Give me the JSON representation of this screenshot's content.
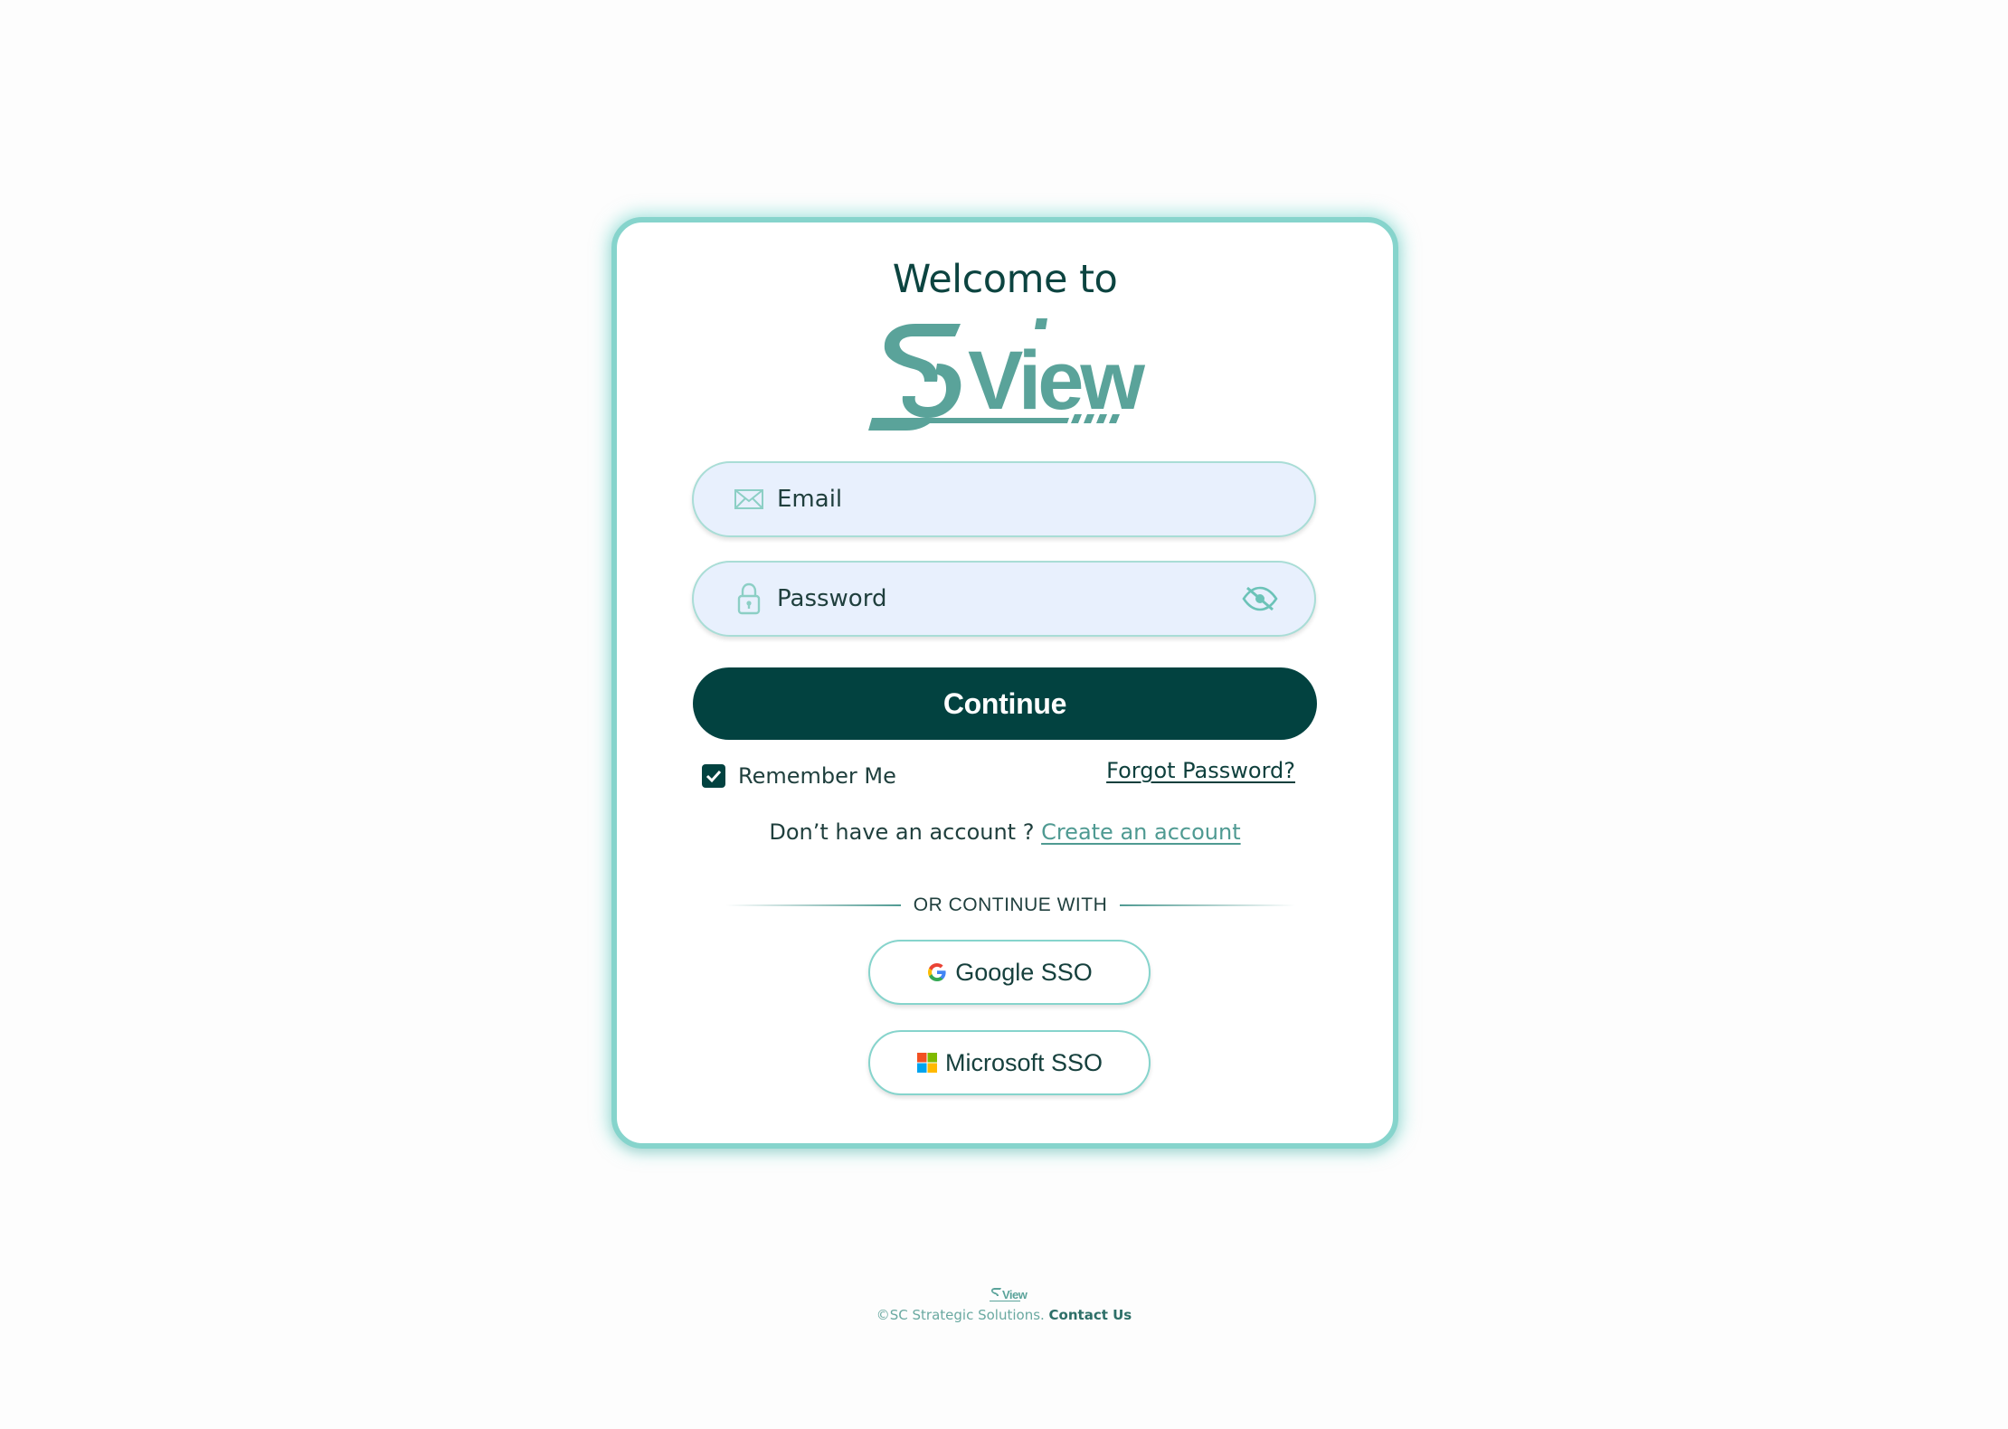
{
  "header": {
    "welcome_text": "Welcome to",
    "logo_name": "SCView"
  },
  "form": {
    "email_placeholder": "Email",
    "email_value": "",
    "password_placeholder": "Password",
    "password_value": "",
    "continue_label": "Continue",
    "remember_label": "Remember Me",
    "remember_checked": true,
    "forgot_label": "Forgot Password?"
  },
  "signup": {
    "prompt": "Don’t have an account ? ",
    "link_label": "Create an account"
  },
  "divider": {
    "text": "OR CONTINUE WITH"
  },
  "sso": {
    "google_label": "Google SSO",
    "microsoft_label": "Microsoft SSO"
  },
  "footer": {
    "copyright": "©SC Strategic Solutions. ",
    "contact_label": "Contact Us"
  },
  "icons": {
    "email": "mail-icon",
    "password": "lock-icon",
    "visibility": "eye-off-icon",
    "remember": "checkmark-icon",
    "google": "google-icon",
    "microsoft": "microsoft-icon"
  },
  "colors": {
    "primary": "#024240",
    "accent": "#5aa39a",
    "card_border": "#86d4cc",
    "field_bg": "#e8f0fd",
    "link": "#4f9a92"
  }
}
